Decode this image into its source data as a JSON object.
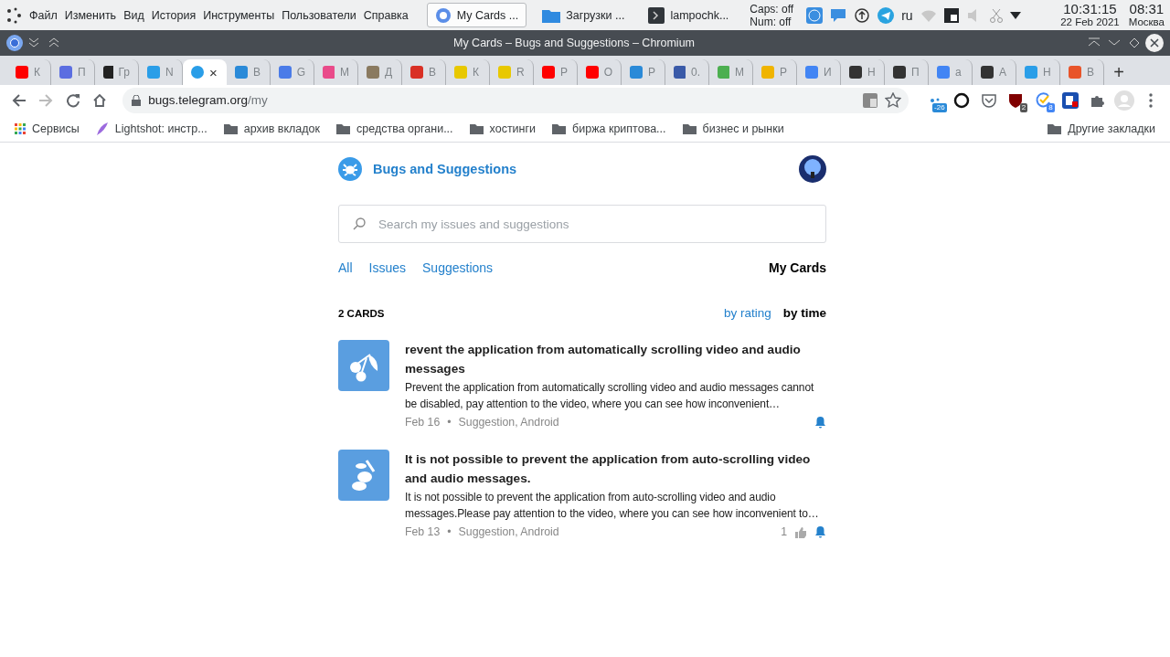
{
  "menu_bar": {
    "items": [
      "Файл",
      "Изменить",
      "Вид",
      "История",
      "Инструменты",
      "Пользователи",
      "Справка"
    ]
  },
  "taskbar": [
    {
      "label": "My Cards ...",
      "selected": true,
      "kind": "browser"
    },
    {
      "label": "Загрузки ...",
      "selected": false,
      "kind": "folder"
    },
    {
      "label": "lampochk...",
      "selected": false,
      "kind": "terminal"
    }
  ],
  "indicators": {
    "caps": "Caps: off",
    "num": "Num: off",
    "layout": "ru"
  },
  "clock": {
    "time": "10:31:15",
    "date": "22 Feb 2021",
    "time2": "08:31",
    "city": "Москва"
  },
  "window": {
    "title": "My Cards – Bugs and Suggestions – Chromium"
  },
  "tabs": [
    {
      "label": "К",
      "color": "#ff0000",
      "selected": false
    },
    {
      "label": "П",
      "color": "#5b6ee1",
      "selected": false
    },
    {
      "label": "Гр",
      "color": "#222222",
      "selected": false
    },
    {
      "label": "N",
      "color": "#2a9ee8",
      "selected": false
    },
    {
      "label": "×",
      "color": "#2a9ee8",
      "selected": true
    },
    {
      "label": "В",
      "color": "#2a8ad8",
      "selected": false
    },
    {
      "label": "G",
      "color": "#4a7be8",
      "selected": false
    },
    {
      "label": "М",
      "color": "#e94b8a",
      "selected": false
    },
    {
      "label": "Д",
      "color": "#8a7a60",
      "selected": false
    },
    {
      "label": "В",
      "color": "#d93025",
      "selected": false
    },
    {
      "label": "К",
      "color": "#e8c800",
      "selected": false
    },
    {
      "label": "R",
      "color": "#e8c800",
      "selected": false
    },
    {
      "label": "Р",
      "color": "#ff0000",
      "selected": false
    },
    {
      "label": "О",
      "color": "#ff0000",
      "selected": false
    },
    {
      "label": "Р",
      "color": "#2a8ad8",
      "selected": false
    },
    {
      "label": "0.",
      "color": "#3a5aa8",
      "selected": false
    },
    {
      "label": "М",
      "color": "#4caf50",
      "selected": false
    },
    {
      "label": "Р",
      "color": "#f0b400",
      "selected": false
    },
    {
      "label": "И",
      "color": "#4285f4",
      "selected": false
    },
    {
      "label": "Н",
      "color": "#333333",
      "selected": false
    },
    {
      "label": "П",
      "color": "#333333",
      "selected": false
    },
    {
      "label": "а",
      "color": "#4285f4",
      "selected": false
    },
    {
      "label": "А",
      "color": "#333333",
      "selected": false
    },
    {
      "label": "Н",
      "color": "#2a9ee8",
      "selected": false
    },
    {
      "label": "В",
      "color": "#e8542a",
      "selected": false
    }
  ],
  "new_tab": "+",
  "address": {
    "host": "bugs.telegram.org",
    "path": "/my"
  },
  "extensions": [
    {
      "badge": "-26",
      "color": "#2a8ad8"
    },
    {
      "badge": "2",
      "color": "#555555"
    },
    {
      "badge": "8",
      "color": "#4285f4"
    }
  ],
  "bookmarks": [
    {
      "label": "Сервисы",
      "kind": "apps"
    },
    {
      "label": "Lightshot: инстр...",
      "kind": "feather"
    },
    {
      "label": "архив вкладок",
      "kind": "folder"
    },
    {
      "label": "средства органи...",
      "kind": "folder"
    },
    {
      "label": "хостинги",
      "kind": "folder"
    },
    {
      "label": "биржа криптова...",
      "kind": "folder"
    },
    {
      "label": "бизнес и рынки",
      "kind": "folder"
    }
  ],
  "other_bookmarks": "Другие закладки",
  "site": {
    "title": "Bugs and Suggestions"
  },
  "search": {
    "placeholder": "Search my issues and suggestions"
  },
  "filters": [
    {
      "label": "All",
      "selected": false
    },
    {
      "label": "Issues",
      "selected": false
    },
    {
      "label": "Suggestions",
      "selected": false
    }
  ],
  "my_cards": {
    "label": "My Cards",
    "selected": true
  },
  "count": "2 CARDS",
  "sort": [
    {
      "label": "by rating",
      "selected": false
    },
    {
      "label": "by time",
      "selected": true
    }
  ],
  "cards": [
    {
      "title": "revent the application from automatically scrolling video and audio messages",
      "text": "Prevent the application from automatically scrolling video and audio messages cannot be disabled, pay attention to the video, where you can see how inconvenient…",
      "date": "Feb 16",
      "separator": "•",
      "tags": "Suggestion, Android",
      "kind": "cherry"
    },
    {
      "title": "It is not possible to prevent the application from auto-scrolling video and audio messages.",
      "text": "It is not possible to prevent the application from auto-scrolling video and audio messages.Please pay attention to the video, where you can see how inconvenient to…",
      "date": "Feb 13",
      "separator": "•",
      "tags": "Suggestion, Android",
      "likes": "1",
      "kind": "beans"
    }
  ]
}
